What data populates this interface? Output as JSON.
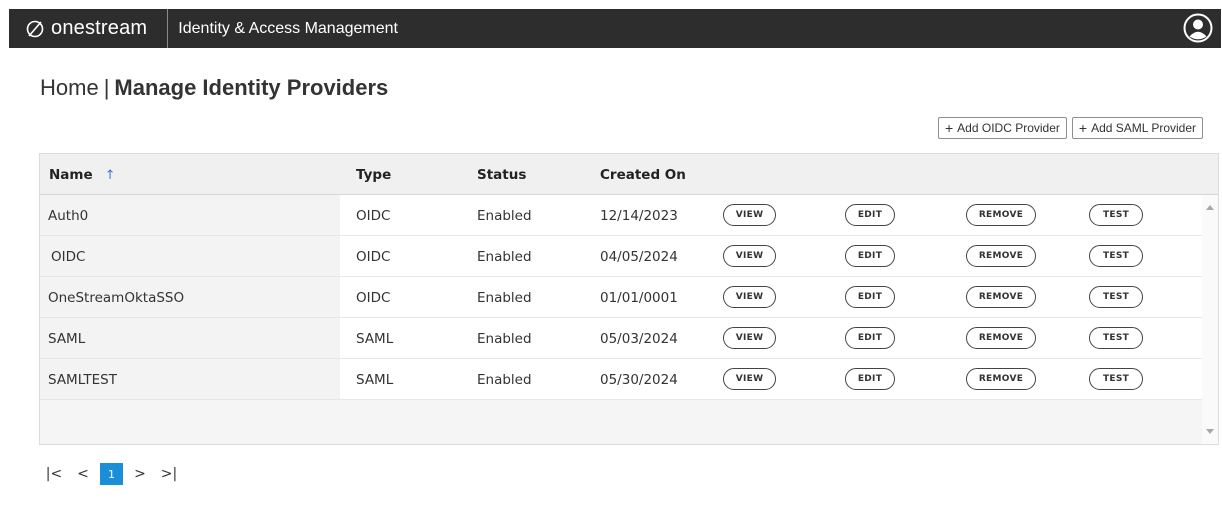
{
  "header": {
    "logo_text": "onestream",
    "app_title": "Identity & Access Management"
  },
  "breadcrumb": {
    "home": "Home",
    "separator": "|",
    "current": "Manage Identity Providers"
  },
  "actions": {
    "add_oidc": "Add OIDC Provider",
    "add_saml": "Add SAML Provider",
    "plus_glyph": "+"
  },
  "grid": {
    "columns": {
      "name": "Name",
      "type": "Type",
      "status": "Status",
      "created_on": "Created On"
    },
    "sort_glyph": "↑",
    "rows": [
      {
        "name": "Auth0",
        "type": "OIDC",
        "status": "Enabled",
        "created_on": "12/14/2023"
      },
      {
        "name": "OIDC",
        "type": "OIDC",
        "status": "Enabled",
        "created_on": "04/05/2024"
      },
      {
        "name": "OneStreamOktaSSO",
        "type": "OIDC",
        "status": "Enabled",
        "created_on": "01/01/0001"
      },
      {
        "name": "SAML",
        "type": "SAML",
        "status": "Enabled",
        "created_on": "05/03/2024"
      },
      {
        "name": "SAMLTEST",
        "type": "SAML",
        "status": "Enabled",
        "created_on": "05/30/2024"
      }
    ],
    "row_actions": {
      "view": "VIEW",
      "edit": "EDIT",
      "remove": "REMOVE",
      "test": "TEST"
    }
  },
  "pagination": {
    "first": "|<",
    "prev": "<",
    "current_page": "1",
    "next": ">",
    "last": ">|"
  },
  "colors": {
    "topbar": "#2d2d2d",
    "accent": "#1a8fd8",
    "sort_arrow": "#3a7bd5"
  }
}
